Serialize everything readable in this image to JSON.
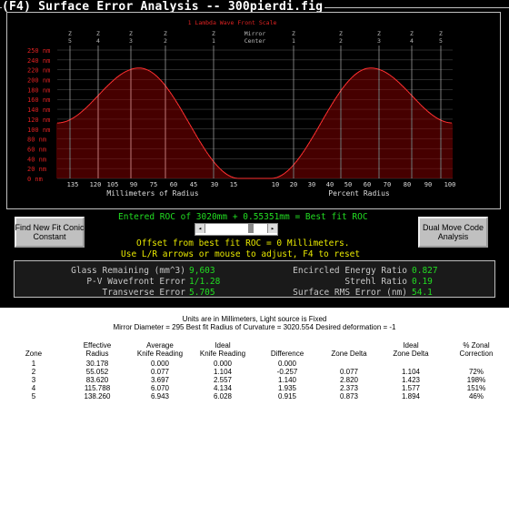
{
  "window": {
    "title": "(F4) Surface Error Analysis -- 300pierdi.fig"
  },
  "chart_data": {
    "type": "bar",
    "scale_label": "1 Lambda Wave Front Scale",
    "ylabels": [
      "250 nm",
      "240 nm",
      "220 nm",
      "200 nm",
      "180 nm",
      "160 nm",
      "140 nm",
      "120 nm",
      "100 nm",
      "80 nm",
      "60 nm",
      "40 nm",
      "20 nm",
      "0 nm"
    ],
    "ylim": [
      0,
      250
    ],
    "left_ticks": [
      "135",
      "120",
      "105",
      "90",
      "75",
      "60",
      "45",
      "30",
      "15"
    ],
    "right_ticks": [
      "10",
      "20",
      "30",
      "40",
      "50",
      "60",
      "70",
      "80",
      "90",
      "100"
    ],
    "xlabel_left": "Millimeters of Radius",
    "xlabel_right": "Percent Radius",
    "zone_markers": [
      {
        "z": "Z",
        "n": "5"
      },
      {
        "z": "Z",
        "n": "4"
      },
      {
        "z": "Z",
        "n": "3"
      },
      {
        "z": "Z",
        "n": "2"
      },
      {
        "z": "Z",
        "n": "1"
      },
      {
        "z": "Mirror",
        "n": "Center"
      },
      {
        "z": "Z",
        "n": "1"
      },
      {
        "z": "Z",
        "n": "2"
      },
      {
        "z": "Z",
        "n": "3"
      },
      {
        "z": "Z",
        "n": "4"
      },
      {
        "z": "Z",
        "n": "5"
      }
    ]
  },
  "buttons": {
    "find_new": "Find New Fit Conic\nConstant",
    "dual_move": "Dual Move Code\nAnalysis"
  },
  "roc": {
    "line1": "Entered ROC of 3020mm + 0.55351mm = Best fit ROC",
    "line2": "Offset from best fit ROC = 0 Millimeters.",
    "line3": "Use L/R arrows or mouse to adjust, F4 to reset"
  },
  "stats": {
    "glass_label": "Glass Remaining (mm^3)",
    "glass_value": "9,603",
    "pv_label": "P-V Wavefront Error",
    "pv_value": "1/1.28",
    "trans_label": "Transverse Error",
    "trans_value": "5.705",
    "energy_label": "Encircled Energy Ratio",
    "energy_value": "0.827",
    "strehl_label": "Strehl Ratio",
    "strehl_value": "0.19",
    "rms_label": "Surface RMS Error (nm)",
    "rms_value": "54.1"
  },
  "report": {
    "line1": "Units are in Millimeters, Light source is Fixed",
    "line2": "Mirror Diameter = 295      Best fit Radius of Curvature = 3020.554      Desired deformation = -1",
    "headers": {
      "zone": "Zone",
      "eff": "Effective\nRadius",
      "avg": "Average\nKnife Reading",
      "ideal": "Ideal\nKnife Reading",
      "diff": "Difference",
      "zdelta": "Zone Delta",
      "izdelta": "Ideal\nZone Delta",
      "pct": "% Zonal\nCorrection"
    },
    "rows": [
      {
        "zone": "1",
        "eff": "30.178",
        "avg": "0.000",
        "ideal": "0.000",
        "diff": "0.000",
        "zd": "",
        "izd": "",
        "pct": ""
      },
      {
        "zone": "2",
        "eff": "55.052",
        "avg": "0.077",
        "ideal": "1.104",
        "diff": "-0.257",
        "zd": "0.077",
        "izd": "1.104",
        "pct": "72%"
      },
      {
        "zone": "3",
        "eff": "83.620",
        "avg": "3.697",
        "ideal": "2.557",
        "diff": "1.140",
        "zd": "2.820",
        "izd": "1.423",
        "pct": "198%"
      },
      {
        "zone": "4",
        "eff": "115.788",
        "avg": "6.070",
        "ideal": "4.134",
        "diff": "1.935",
        "zd": "2.373",
        "izd": "1.577",
        "pct": "151%"
      },
      {
        "zone": "5",
        "eff": "138.260",
        "avg": "6.943",
        "ideal": "6.028",
        "diff": "0.915",
        "zd": "0.873",
        "izd": "1.894",
        "pct": "46%"
      }
    ]
  }
}
